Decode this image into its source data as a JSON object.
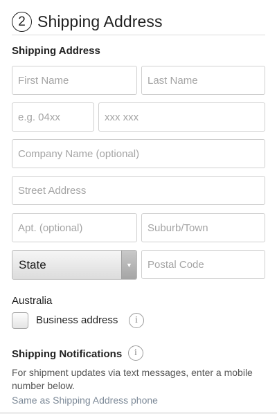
{
  "header": {
    "step_number": "2",
    "title": "Shipping Address"
  },
  "shipping_address": {
    "section_label": "Shipping Address",
    "first_name": {
      "placeholder": "First Name",
      "value": ""
    },
    "last_name": {
      "placeholder": "Last Name",
      "value": ""
    },
    "phone_area": {
      "placeholder": "e.g. 04xx",
      "value": ""
    },
    "phone_number": {
      "placeholder": "xxx xxx",
      "value": ""
    },
    "company": {
      "placeholder": "Company Name (optional)",
      "value": ""
    },
    "street": {
      "placeholder": "Street Address",
      "value": ""
    },
    "apt": {
      "placeholder": "Apt. (optional)",
      "value": ""
    },
    "suburb": {
      "placeholder": "Suburb/Town",
      "value": ""
    },
    "state": {
      "selected": "State",
      "arrow_icon": "chevron-down-icon"
    },
    "postal": {
      "placeholder": "Postal Code",
      "value": ""
    },
    "country": "Australia",
    "business_checkbox": {
      "label": "Business address",
      "checked": false,
      "info_icon": "i"
    }
  },
  "notifications": {
    "section_label": "Shipping Notifications",
    "info_icon": "i",
    "description": "For shipment updates via text messages, enter a mobile number below.",
    "same_as_link": "Same as Shipping Address phone"
  }
}
